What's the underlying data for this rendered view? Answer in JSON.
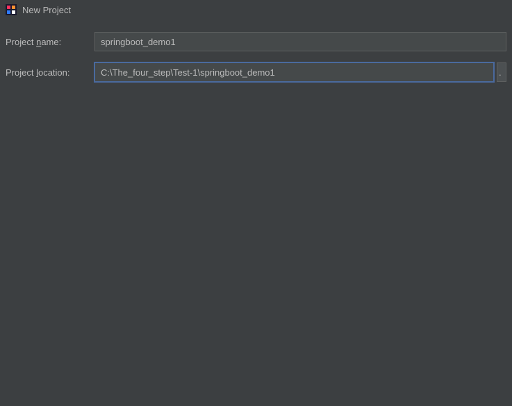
{
  "titlebar": {
    "title": "New Project"
  },
  "form": {
    "projectName": {
      "labelPrefix": "Project ",
      "labelMnemonic": "n",
      "labelSuffix": "ame:",
      "value": "springboot_demo1"
    },
    "projectLocation": {
      "labelPrefix": "Project ",
      "labelMnemonic": "l",
      "labelSuffix": "ocation:",
      "value": "C:\\The_four_step\\Test-1\\springboot_demo1",
      "browseLabel": "."
    }
  }
}
